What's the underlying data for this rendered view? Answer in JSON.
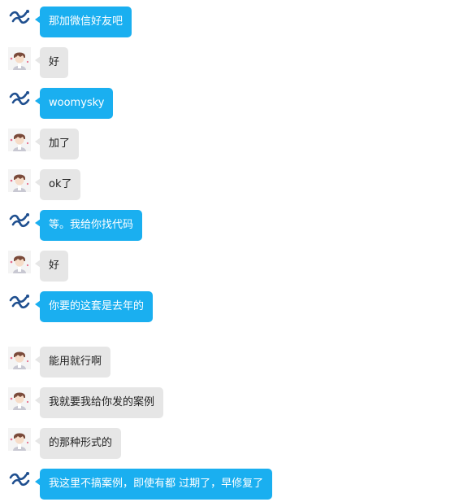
{
  "conversation": {
    "messages": [
      {
        "sender": "me",
        "text": "那加微信好友吧"
      },
      {
        "sender": "other",
        "text": "好"
      },
      {
        "sender": "me",
        "text": "woomysky"
      },
      {
        "sender": "other",
        "text": "加了"
      },
      {
        "sender": "other",
        "text": "ok了"
      },
      {
        "sender": "me",
        "text": "等。我给你找代码"
      },
      {
        "sender": "other",
        "text": "好"
      },
      {
        "sender": "me",
        "text": "你要的这套是去年的"
      },
      {
        "sender": "other",
        "text": "能用就行啊"
      },
      {
        "sender": "other",
        "text": "我就要我给你发的案例"
      },
      {
        "sender": "other",
        "text": "的那种形式的"
      },
      {
        "sender": "me",
        "text": "我这里不搞案例，即使有都 过期了，早修复了"
      }
    ]
  },
  "avatars": {
    "me": {
      "icon": "wave-logo-icon",
      "color": "#1f4f8f"
    },
    "other": {
      "icon": "anime-boy-avatar-icon",
      "color": "#7a4a3a"
    }
  },
  "colors": {
    "me_bubble": "#1aaff0",
    "other_bubble": "#e6e6e6"
  }
}
